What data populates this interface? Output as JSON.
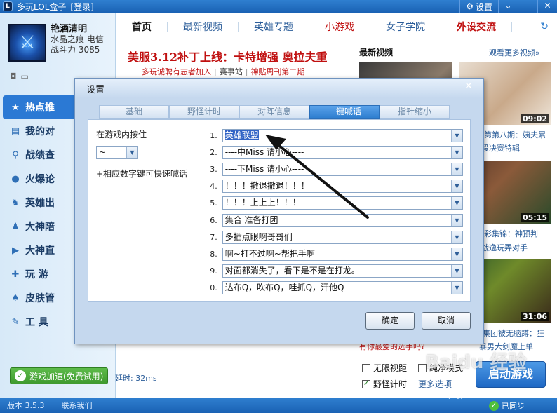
{
  "app": {
    "logo": "L",
    "title": "多玩LOL盒子",
    "login": "[登录]",
    "settings_label": "设置",
    "menu_glyph": "⌄",
    "minimize_glyph": "—"
  },
  "profile": {
    "nickname": "艳酒清明",
    "server": "水晶之痕 电信",
    "power_label": "战斗力",
    "power_value": "3085"
  },
  "sidebar": {
    "items": [
      {
        "label": "热点推",
        "icon": "star-icon",
        "glyph": "★",
        "active": true
      },
      {
        "label": "我的对",
        "icon": "profile-card-icon",
        "glyph": "▤",
        "active": false
      },
      {
        "label": "战绩查",
        "icon": "search-icon",
        "glyph": "⚲",
        "active": false
      },
      {
        "label": "火爆论",
        "icon": "chat-bubble-icon",
        "glyph": "●",
        "active": false
      },
      {
        "label": "英雄出",
        "icon": "hero-icon",
        "glyph": "♞",
        "active": false
      },
      {
        "label": "大神陪",
        "icon": "users-icon",
        "glyph": "♟",
        "active": false
      },
      {
        "label": "大神直",
        "icon": "play-circle-icon",
        "glyph": "▶",
        "active": false
      },
      {
        "label": "玩  游",
        "icon": "gamepad-icon",
        "glyph": "✚",
        "active": false
      },
      {
        "label": "皮肤管",
        "icon": "skin-icon",
        "glyph": "♠",
        "active": false
      },
      {
        "label": "工  具",
        "icon": "wrench-icon",
        "glyph": "✎",
        "active": false
      }
    ],
    "speedup_label": "游戏加速(免费试用)",
    "latency": "延时: 32ms"
  },
  "topnav": {
    "tabs": [
      "首页",
      "最新视频",
      "英雄专题",
      "小游戏",
      "女子学院",
      "外设交流"
    ],
    "refresh_glyph": "↻"
  },
  "headline": {
    "title": "美服3.12补丁上线：卡特增强 奥拉夫重",
    "links": [
      "多玩诚聘有志者加入",
      "赛事站",
      "神贴周刊第二期"
    ]
  },
  "videos": {
    "section_title": "最新视频",
    "more": "观看更多视频»",
    "items": [
      {
        "duration": "09:02",
        "caption_1": "第第八期：姨夫累",
        "caption_2": "段决赛特辑"
      },
      {
        "duration": "05:15",
        "caption_1": "彩集锦：神预判",
        "caption_2": "战逸玩弄对手"
      },
      {
        "duration": "31:06",
        "caption_1": "集团被无脑蹲：狂",
        "caption_2": "暴男大剑魔上单"
      }
    ],
    "left_caption": "有你最爱的选手吗?"
  },
  "dialog": {
    "title": "设置",
    "close_glyph": "✕",
    "tabs": [
      {
        "label": "基础",
        "active": false
      },
      {
        "label": "野怪计时",
        "active": false
      },
      {
        "label": "对阵信息",
        "active": false
      },
      {
        "label": "一键喊话",
        "active": true
      },
      {
        "label": "指针缩小",
        "active": false
      }
    ],
    "hotkey_label": "在游戏内按住",
    "hotkey_value": "~",
    "hotkey_hint": "+相应数字键可快速喊话",
    "phrases": [
      {
        "num": "1.",
        "text": "英雄联盟",
        "selected": true
      },
      {
        "num": "2.",
        "text": "----中Miss 请小心----",
        "selected": false
      },
      {
        "num": "3.",
        "text": "----下Miss 请小心----",
        "selected": false
      },
      {
        "num": "4.",
        "text": "！！！撤退撤退！！！",
        "selected": false
      },
      {
        "num": "5.",
        "text": "！！！上上上！！！",
        "selected": false
      },
      {
        "num": "6.",
        "text": "集合 准备打团",
        "selected": false
      },
      {
        "num": "7.",
        "text": "多插点眼啊哥哥们",
        "selected": false
      },
      {
        "num": "8.",
        "text": "啊~打不过啊~帮把手啊",
        "selected": false
      },
      {
        "num": "9.",
        "text": "对面都消失了，看下是不是在打龙。",
        "selected": false
      },
      {
        "num": "0.",
        "text": "达布Q，吹布Q，哇抓Q，汗他Q",
        "selected": false
      }
    ],
    "ok_label": "确定",
    "cancel_label": "取消"
  },
  "options": {
    "no_border": {
      "label": "无限视距",
      "checked": false
    },
    "pure": {
      "label": "纯净模式",
      "checked": false
    },
    "jungle_timer": {
      "label": "野怪计时",
      "checked": true
    },
    "more": "更多选项",
    "start_label": "启动游戏"
  },
  "footer": {
    "version": "版本 3.5.3",
    "contact": "联系我们",
    "sync": "已同步"
  },
  "watermark": {
    "text": "Baidu 经验",
    "url": "jingyan.baidu.com"
  }
}
